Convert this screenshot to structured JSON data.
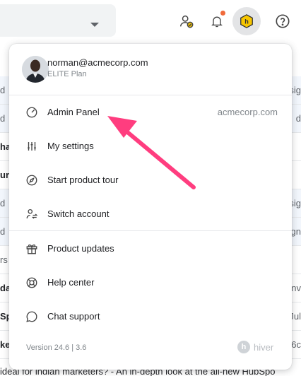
{
  "toolbar": {
    "search_dropdown": "search-filter-dropdown",
    "icons": [
      "account-status-icon",
      "notifications-icon",
      "hiver-icon",
      "help-icon"
    ],
    "notification_dot_color": "#f06a3a"
  },
  "background": {
    "rows": [
      {
        "left": "d",
        "right": "sig"
      },
      {
        "left": "d",
        "right": "d"
      },
      {
        "left": "ha",
        "right": ""
      },
      {
        "left": "ur",
        "right": ""
      },
      {
        "left": "d",
        "right": "sig"
      },
      {
        "left": "d",
        "right": "sign"
      },
      {
        "left": "rs",
        "right": ""
      },
      {
        "left": "dai",
        "right": "inv"
      },
      {
        "left": "Sp",
        "right": "Jul"
      },
      {
        "left": "ke",
        "right": "6c"
      }
    ],
    "bottom_text": "ideal for indian marketers? - An in-depth look at the all-new HubSpo"
  },
  "menu": {
    "user": {
      "email": "norman@acmecorp.com",
      "plan": "ELITE Plan"
    },
    "items": [
      {
        "label": "Admin Panel",
        "meta": "acmecorp.com",
        "icon": "gauge-icon"
      },
      {
        "label": "My settings",
        "meta": "",
        "icon": "sliders-icon"
      },
      {
        "label": "Start product tour",
        "meta": "",
        "icon": "compass-icon"
      },
      {
        "label": "Switch account",
        "meta": "",
        "icon": "switch-user-icon"
      },
      {
        "label": "Product updates",
        "meta": "",
        "icon": "gift-icon"
      },
      {
        "label": "Help center",
        "meta": "",
        "icon": "lifebuoy-icon"
      },
      {
        "label": "Chat support",
        "meta": "",
        "icon": "chat-bubble-icon"
      }
    ],
    "version": "Version 24.6 | 3.6",
    "brand": "hiver"
  },
  "colors": {
    "annotation_arrow": "#ff3d7f",
    "hiver_badge": "#f7c600"
  }
}
